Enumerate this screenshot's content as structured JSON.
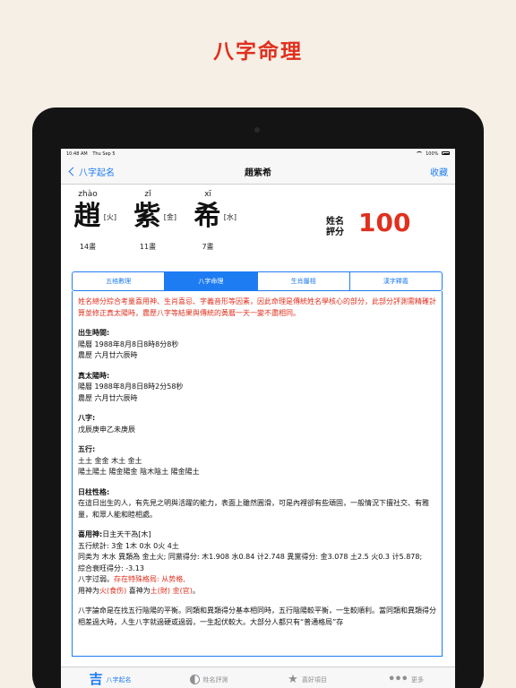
{
  "headline": "八字命理",
  "status": {
    "time": "10:48 AM",
    "date": "Thu Sep 5",
    "battery": "100%"
  },
  "nav": {
    "back": "八字起名",
    "title": "趙紫希",
    "fav": "收藏"
  },
  "chars": [
    {
      "pinyin": "zhào",
      "hanzi": "趙",
      "element": "[火]",
      "strokes": "14畫"
    },
    {
      "pinyin": "zǐ",
      "hanzi": "紫",
      "element": "[金]",
      "strokes": "11畫"
    },
    {
      "pinyin": "xī",
      "hanzi": "希",
      "element": "[水]",
      "strokes": "7畫"
    }
  ],
  "score": {
    "label1": "姓名",
    "label2": "評分",
    "value": "100"
  },
  "tabs": [
    "五格數理",
    "八字命理",
    "生肖屬相",
    "漢字釋義"
  ],
  "content": {
    "intro": "姓名總分綜合考量喜用神、生肖喜忌、字義音形等因素，因此命理是傳統姓名學核心的部分，此部分評測需精確計算並修正真太陽時，農歷八字等結果與傳統的黃曆一天一變不盡相同。",
    "birth": {
      "title": "出生時間:",
      "l1": "陽曆 1988年8月8日8時8分8秒",
      "l2": "農歷 六月廿六辰時"
    },
    "solar": {
      "title": "真太陽時:",
      "l1": "陽曆 1988年8月8日8時2分58秒",
      "l2": "農歷 六月廿六辰時"
    },
    "bazi": {
      "title": "八字:",
      "l1": "戊辰庚申乙未庚辰"
    },
    "wuxing": {
      "title": "五行:",
      "l1": "土土 金金 木土 金土",
      "l2": "陽土陽土 陽金陽金 陰木陰土 陽金陽土"
    },
    "rizhu": {
      "title": "日柱性格:",
      "l1": "在這日出生的人，有先見之明與活躍的能力，表面上雖然圓滑，可是內裡卻有些頑固，一般情況下擅社交、有雅量，和眾人能和睦相處。"
    },
    "xiyong": {
      "title": "喜用神:",
      "title_rest": "日主天干為[木]",
      "l1": "五行統計: 3金 1木 0水 0火 4土",
      "l2": "同类为 木水 異類為 金土火; 同黨得分: 木1.908 水0.84 计2.748 異黨得分: 金3.078 土2.5 火0.3 计5.878;",
      "l3": "綜合衰旺得分: -3.13",
      "l4_a": "八字过弱。",
      "l4_b": "存在特殊格局: 从势格,",
      "l5_a": "用神为",
      "l5_b": "火(食伤)",
      "l5_c": " 喜神为",
      "l5_d": "土(財) 金(官)",
      "l5_e": "。"
    },
    "outro": "八字論命是在找五行陰陽的平衡。同類和異類得分基本相同時，五行陰陽較平衡，一生較順利。當同類和異類得分相差過大時，人生八字就過硬或過弱，一生起伏較大。大部分人都只有“普通格局”存"
  },
  "tabbar": [
    {
      "icon": "ji-icon",
      "glyph": "吉",
      "label": "八字起名"
    },
    {
      "icon": "yinyang-icon",
      "glyph": "",
      "label": "姓名評測"
    },
    {
      "icon": "star-icon",
      "glyph": "★",
      "label": "喜好項目"
    },
    {
      "icon": "dots-icon",
      "glyph": "•••",
      "label": "更多"
    }
  ],
  "colors": {
    "accent": "#1e7cf2",
    "red": "#e0301e",
    "background": "#f5efe6"
  }
}
